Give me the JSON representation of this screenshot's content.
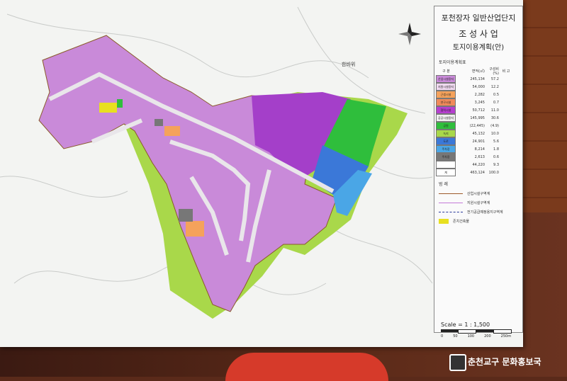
{
  "title": {
    "line1": "포천장자 일반산업단지",
    "line2": "조 성 사 업",
    "line3": "토지이용계획(안)"
  },
  "map": {
    "place_label": "한바위",
    "compass_icon": "compass-rose-icon",
    "scale_text": "Scale = 1 : 1,500",
    "scale_ticks": [
      "0",
      "50",
      "100",
      "200",
      "250m"
    ]
  },
  "legend_table": {
    "heading": "토지이용계획표",
    "columns": [
      "구 분",
      "면적(㎡)",
      "구성비(%)",
      "비 고"
    ],
    "rows": [
      {
        "label": "산업시설용지",
        "area": "245,134",
        "ratio": "57.2",
        "color": "#c98ad9"
      },
      {
        "label": "지원시설용지",
        "area": "54,000",
        "ratio": "12.2",
        "color": "#f0d9f0"
      },
      {
        "label": "근생시설",
        "area": "2,282",
        "ratio": "0.5",
        "color": "#f5a25b"
      },
      {
        "label": "연구시설",
        "area": "3,245",
        "ratio": "0.7",
        "color": "#f08a5a"
      },
      {
        "label": "협력시설",
        "area": "50,712",
        "ratio": "11.0",
        "color": "#b63fd0"
      },
      {
        "label": "공공시설용지",
        "area": "145,995",
        "ratio": "30.6",
        "color": "#f0f0f0"
      },
      {
        "label": "공원",
        "area": "(22,445)",
        "ratio": "(4.9)",
        "color": "#2fbe3c"
      },
      {
        "label": "녹지",
        "area": "45,132",
        "ratio": "10.0",
        "color": "#a9d84a"
      },
      {
        "label": "도로",
        "area": "24,901",
        "ratio": "5.6",
        "color": "#3b78d8"
      },
      {
        "label": "주차장",
        "area": "8,214",
        "ratio": "1.8",
        "color": "#4aa6e6"
      },
      {
        "label": "주차장",
        "area": "2,613",
        "ratio": "0.6",
        "color": "#777777"
      },
      {
        "label": "",
        "area": "44,220",
        "ratio": "9.3",
        "color": "#ffffff"
      },
      {
        "label": "계",
        "area": "463,124",
        "ratio": "100.0",
        "color": "#ffffff"
      }
    ]
  },
  "legend_symbols": {
    "heading": "범 례",
    "items": [
      {
        "label": "산업시설구역계",
        "color": "#9c5a2a"
      },
      {
        "label": "지원시설구역계",
        "color": "#c37ad8"
      },
      {
        "label": "전기공급예정용지구역계",
        "color": "#2a3a9a"
      },
      {
        "label": "존치건축물",
        "color": "#e8e020"
      }
    ]
  },
  "credit": "춘천교구 문화홍보국",
  "colors": {
    "industrial": "#c98ad9",
    "support": "#9b3fd6",
    "park": "#2fbe3c",
    "buffer": "#a9d84a",
    "road": "#3b78d8",
    "parking": "#4aa6e6"
  }
}
